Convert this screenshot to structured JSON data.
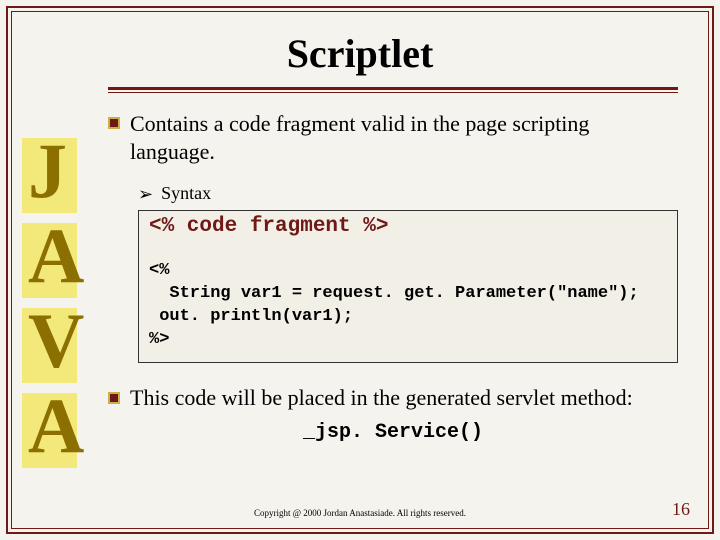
{
  "title": "Scriptlet",
  "java_letters": [
    "J",
    "A",
    "V",
    "A"
  ],
  "bullet1": "Contains a code fragment valid in the page scripting language.",
  "syntax_label": "Syntax",
  "syntax_code": "<% code fragment %>",
  "example_code": "<%\n  String var1 = request. get. Parameter(\"name\");\n out. println(var1);\n%>",
  "bullet2_part_a": "This code will be placed in the generated servlet",
  "bullet2_part_b": " method:",
  "servlet_method": "_jsp. Service()",
  "copyright": "Copyright @ 2000 Jordan Anastasiade.  All rights reserved.",
  "page_num": "16"
}
